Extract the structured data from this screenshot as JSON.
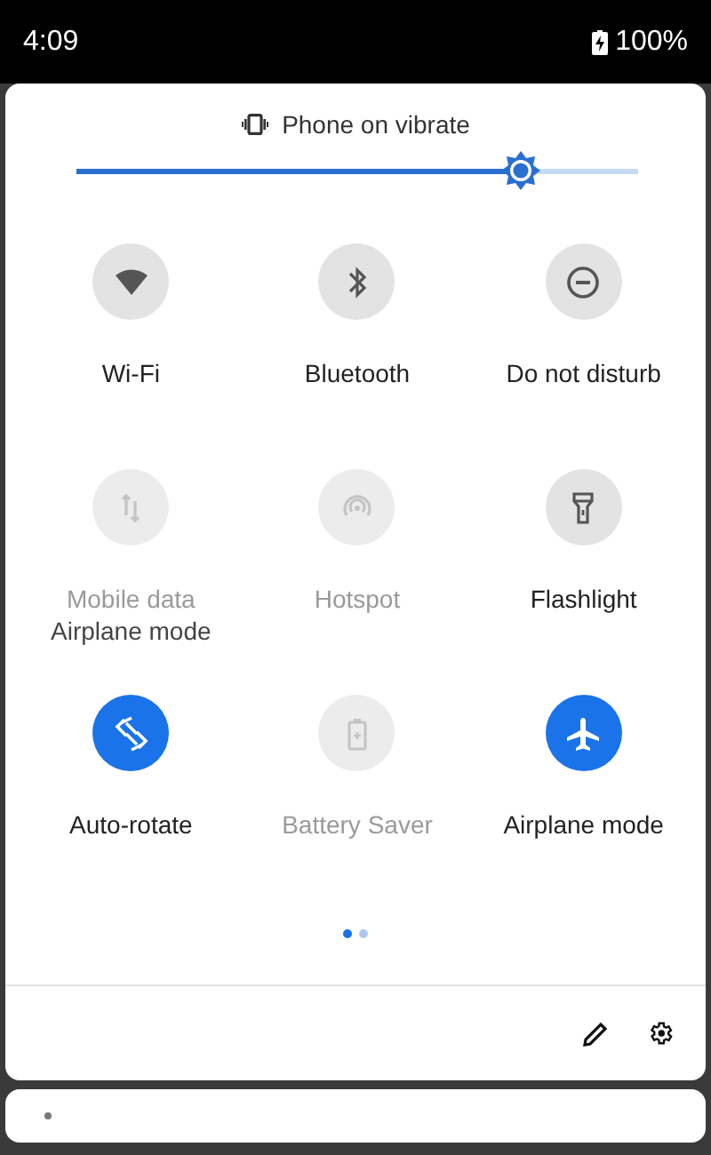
{
  "status_bar": {
    "time": "4:09",
    "battery": "100%"
  },
  "ringer": {
    "label": "Phone on vibrate"
  },
  "brightness": {
    "level": 0.79
  },
  "tiles": [
    {
      "label": "Wi-Fi",
      "on": false,
      "disabled": false
    },
    {
      "label": "Bluetooth",
      "on": false,
      "disabled": false
    },
    {
      "label": "Do not disturb",
      "on": false,
      "disabled": false
    },
    {
      "label": "Mobile data",
      "on": false,
      "disabled": true,
      "overlay_label": "Airplane mode"
    },
    {
      "label": "Hotspot",
      "on": false,
      "disabled": true
    },
    {
      "label": "Flashlight",
      "on": false,
      "disabled": false
    },
    {
      "label": "Auto-rotate",
      "on": true,
      "disabled": false
    },
    {
      "label": "Battery Saver",
      "on": false,
      "disabled": true
    },
    {
      "label": "Airplane mode",
      "on": true,
      "disabled": false
    }
  ],
  "pages": [
    {
      "selected": true
    },
    {
      "selected": false
    }
  ]
}
